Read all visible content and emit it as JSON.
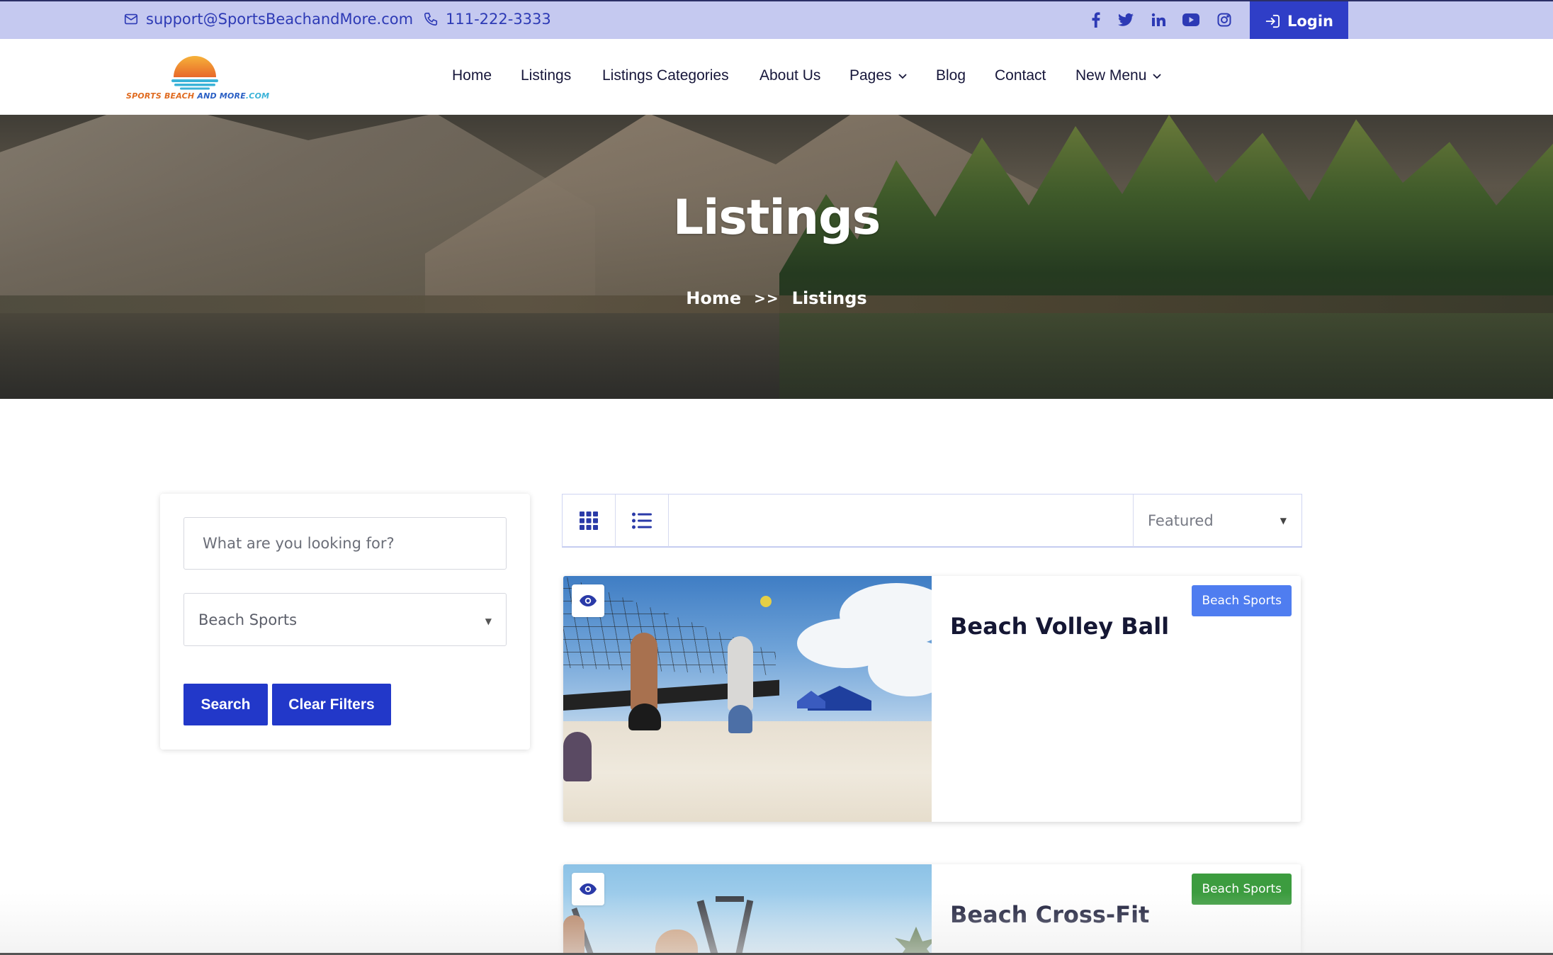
{
  "topbar": {
    "email": "support@SportsBeachandMore.com",
    "phone": "111-222-3333",
    "social": [
      "facebook-icon",
      "twitter-icon",
      "linkedin-icon",
      "youtube-icon",
      "instagram-icon"
    ],
    "login_label": "Login"
  },
  "logo": {
    "wordmark_part1": "SPORTS BEACH",
    "wordmark_part2": " AND MORE",
    "wordmark_part3": ".COM"
  },
  "nav": {
    "items": [
      {
        "label": "Home"
      },
      {
        "label": "Listings"
      },
      {
        "label": "Listings Categories"
      },
      {
        "label": "About Us"
      },
      {
        "label": "Pages"
      },
      {
        "label": "Blog"
      },
      {
        "label": "Contact"
      },
      {
        "label": "New Menu"
      }
    ]
  },
  "hero": {
    "title": "Listings",
    "breadcrumb": {
      "home": "Home",
      "separator": ">>",
      "current": "Listings"
    }
  },
  "filters": {
    "search_placeholder": "What are you looking for?",
    "category_selected": "Beach Sports",
    "search_label": "Search",
    "clear_label": "Clear Filters"
  },
  "toolbar": {
    "sort_selected": "Featured"
  },
  "listings": [
    {
      "title": "Beach Volley Ball",
      "category": "Beach Sports",
      "badge_color": "#4f7df0"
    },
    {
      "title": "Beach Cross-Fit",
      "category": "Beach Sports",
      "badge_color": "#3c9c3f"
    }
  ],
  "colors": {
    "accent": "#2238c9",
    "topbar_bg": "#c5c9f0"
  }
}
